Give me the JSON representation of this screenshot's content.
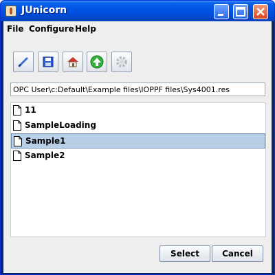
{
  "window": {
    "title": "JUnicorn"
  },
  "menubar": {
    "items": [
      "File",
      "Configure",
      "Help"
    ]
  },
  "toolbar": {
    "icons": [
      "pen-icon",
      "save-icon",
      "house-icon",
      "upload-arrow-icon",
      "gear-icon"
    ]
  },
  "path": {
    "value": "OPC User\\c:Default\\Example files\\IOPPF files\\Sys4001.res"
  },
  "file_list": {
    "items": [
      "11",
      "SampleLoading",
      "Sample1",
      "Sample2"
    ],
    "selected": "Sample1"
  },
  "buttons": {
    "select": "Select",
    "cancel": "Cancel"
  },
  "colors": {
    "titlebar": "#0055e5",
    "selection": "#b8cfe5",
    "window_bg": "#eeeeee"
  }
}
